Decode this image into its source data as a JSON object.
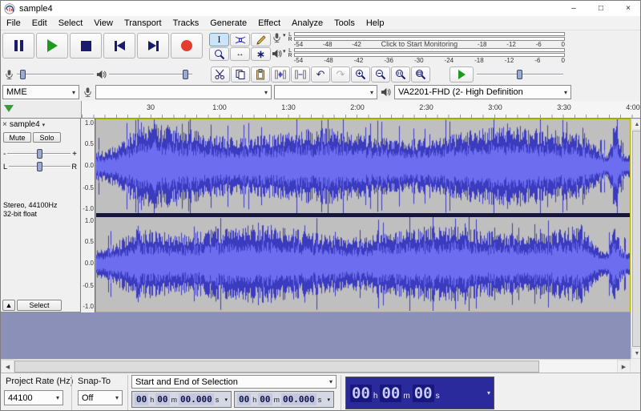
{
  "window": {
    "title": "sample4"
  },
  "icons": {
    "minimize": "–",
    "maximize": "□",
    "close": "×",
    "dropdown": "▾",
    "collapse": "▲",
    "undo": "↶",
    "redo": "↷",
    "timeshift": "↔",
    "multitool": "∗",
    "ibeam": "I",
    "scroll_left": "◀",
    "scroll_right": "▶",
    "scroll_up": "▲",
    "scroll_down": "▼",
    "track_close": "×"
  },
  "menu": {
    "items": [
      "File",
      "Edit",
      "Select",
      "View",
      "Transport",
      "Tracks",
      "Generate",
      "Effect",
      "Analyze",
      "Tools",
      "Help"
    ]
  },
  "meters": {
    "record": {
      "left": "L",
      "right": "R",
      "scale_left": [
        "-54",
        "-48",
        "-42"
      ],
      "monitor": "Click to Start Monitoring",
      "scale_right": [
        "-18",
        "-12",
        "-6",
        "0"
      ]
    },
    "play": {
      "left": "L",
      "right": "R",
      "scale": [
        "-54",
        "-48",
        "-42",
        "-36",
        "-30",
        "-24",
        "-18",
        "-12",
        "-6",
        "0"
      ]
    }
  },
  "device": {
    "host": "MME",
    "recording": "",
    "channels": "",
    "playback": "VA2201-FHD (2- High Definition"
  },
  "timeline": {
    "labels": [
      "30",
      "1:00",
      "1:30",
      "2:00",
      "2:30",
      "3:00",
      "3:30",
      "4:00"
    ]
  },
  "track": {
    "name": "sample4",
    "mute": "Mute",
    "solo": "Solo",
    "gain_min": "-",
    "gain_max": "+",
    "pan_left": "L",
    "pan_right": "R",
    "info_line1": "Stereo, 44100Hz",
    "info_line2": "32-bit float",
    "select": "Select",
    "ruler": [
      "1.0",
      "0.5",
      "0.0",
      "-0.5",
      "-1.0"
    ]
  },
  "selection": {
    "rate_label": "Project Rate (Hz)",
    "rate_value": "44100",
    "snap_label": "Snap-To",
    "snap_value": "Off",
    "mode": "Start and End of Selection",
    "t_h": "00",
    "t_m": "00",
    "t_s": "00.000",
    "u_h": "h",
    "u_m": "m",
    "u_s": "s",
    "p_h": "00",
    "p_m": "00",
    "p_s": "00"
  },
  "colors": {
    "waveform": "#3b3bc0",
    "waveform_rms": "#6d6df0",
    "track_bg": "#bfbfbf",
    "play_green": "#1d9b1d",
    "record_red": "#e23d2e",
    "below_tracks": "#8a90b8"
  }
}
